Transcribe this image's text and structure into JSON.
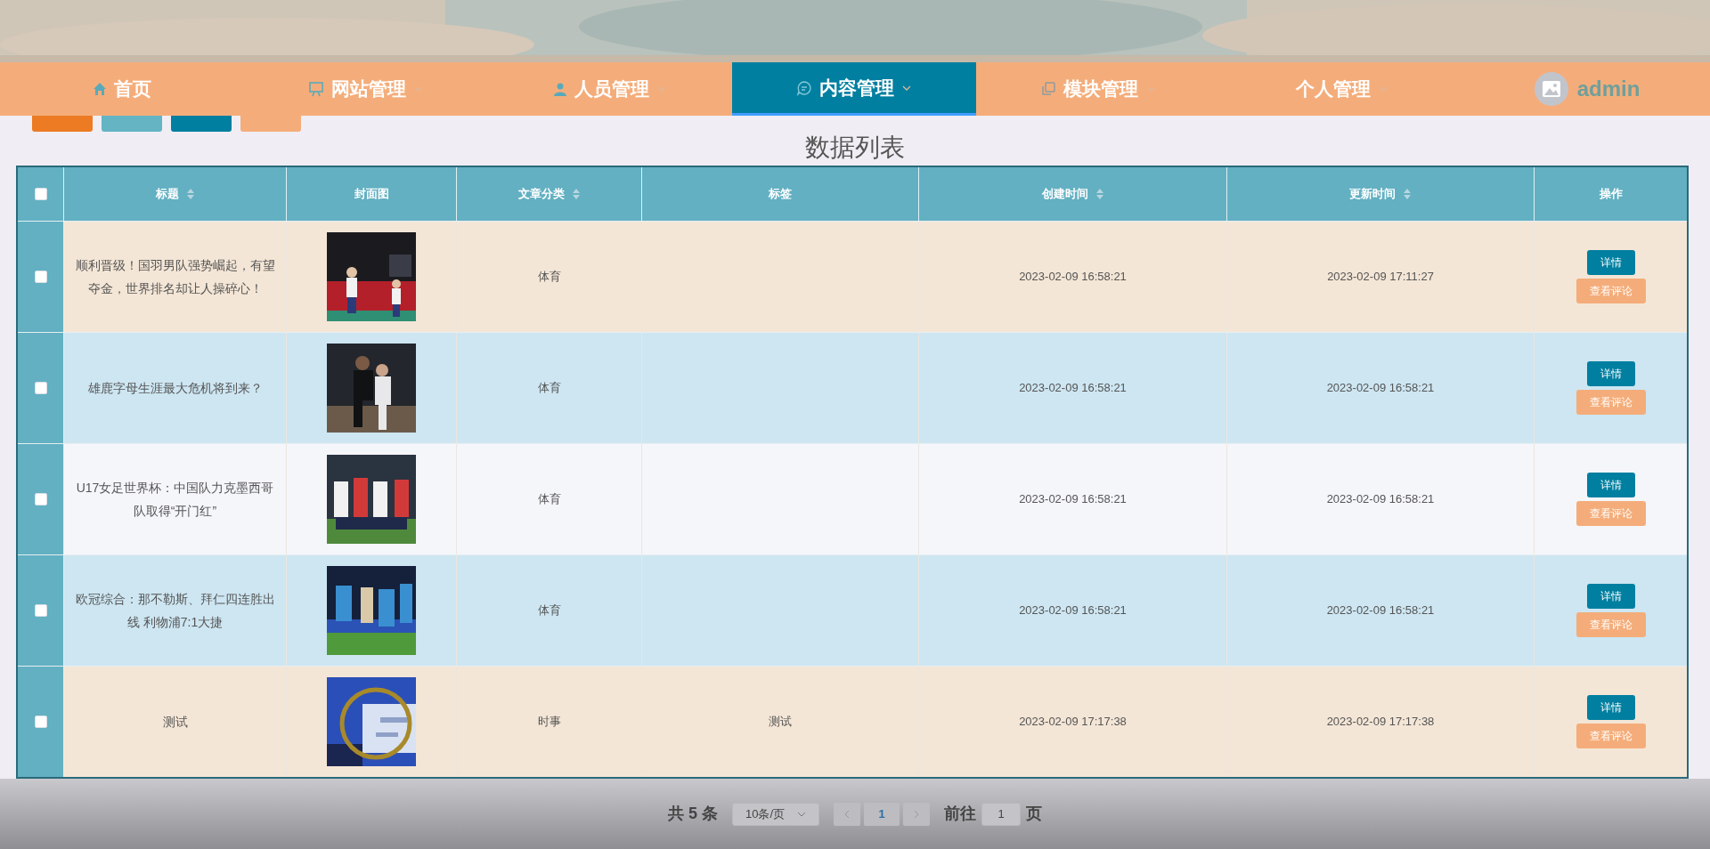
{
  "nav": {
    "items": [
      {
        "label": "首页",
        "dropdown": false,
        "selected": false
      },
      {
        "label": "网站管理",
        "dropdown": true,
        "selected": false
      },
      {
        "label": "人员管理",
        "dropdown": true,
        "selected": false
      },
      {
        "label": "内容管理",
        "dropdown": true,
        "selected": true
      },
      {
        "label": "模块管理",
        "dropdown": true,
        "selected": false
      },
      {
        "label": "个人管理",
        "dropdown": true,
        "selected": false
      }
    ],
    "user": "admin"
  },
  "toolbar_buttons": [
    {
      "color": "#ec7b24"
    },
    {
      "color": "#64b4c4"
    },
    {
      "color": "#007fa0"
    },
    {
      "color": "#f4ad7a"
    }
  ],
  "title": "数据列表",
  "table": {
    "select_all": {
      "checked": false
    },
    "columns": [
      {
        "label": "标题",
        "sortable": true
      },
      {
        "label": "封面图",
        "sortable": false
      },
      {
        "label": "文章分类",
        "sortable": true
      },
      {
        "label": "标签",
        "sortable": false
      },
      {
        "label": "创建时间",
        "sortable": true
      },
      {
        "label": "更新时间",
        "sortable": true
      },
      {
        "label": "操作",
        "sortable": false
      }
    ],
    "rows": [
      {
        "checked": false,
        "title": "顺利晋级！国羽男队强势崛起，有望夺金，世界排名却让人操碎心！",
        "category": "体育",
        "created": "2023-02-09 16:58:21",
        "updated": "2023-02-09 17:11:27",
        "actions": [
          "详情",
          "查看评论"
        ]
      },
      {
        "checked": false,
        "title": "雄鹿字母生涯最大危机将到来？",
        "category": "体育",
        "created": "2023-02-09 16:58:21",
        "updated": "2023-02-09 16:58:21",
        "actions": [
          "详情",
          "查看评论"
        ]
      },
      {
        "checked": false,
        "title": "U17女足世界杯：中国队力克墨西哥队取得“开门红”",
        "category": "体育",
        "created": "2023-02-09 16:58:21",
        "updated": "2023-02-09 16:58:21",
        "actions": [
          "详情",
          "查看评论"
        ]
      },
      {
        "checked": false,
        "title": "欧冠综合：那不勒斯、拜仁四连胜出线 利物浦7:1大捷",
        "category": "体育",
        "created": "2023-02-09 16:58:21",
        "updated": "2023-02-09 16:58:21",
        "actions": [
          "详情",
          "查看评论"
        ]
      },
      {
        "checked": false,
        "title": "测试",
        "category": "时事",
        "tag": "测试",
        "created": "2023-02-09 17:17:38",
        "updated": "2023-02-09 17:17:38",
        "actions": [
          "详情",
          "查看评论"
        ]
      }
    ]
  },
  "pagination": {
    "total": "共 5 条",
    "page_size": "10条/页",
    "pages": [
      {
        "label": "1",
        "selected": true
      }
    ],
    "goto_label": "前往",
    "goto_value": "1",
    "goto_suffix": "页"
  }
}
